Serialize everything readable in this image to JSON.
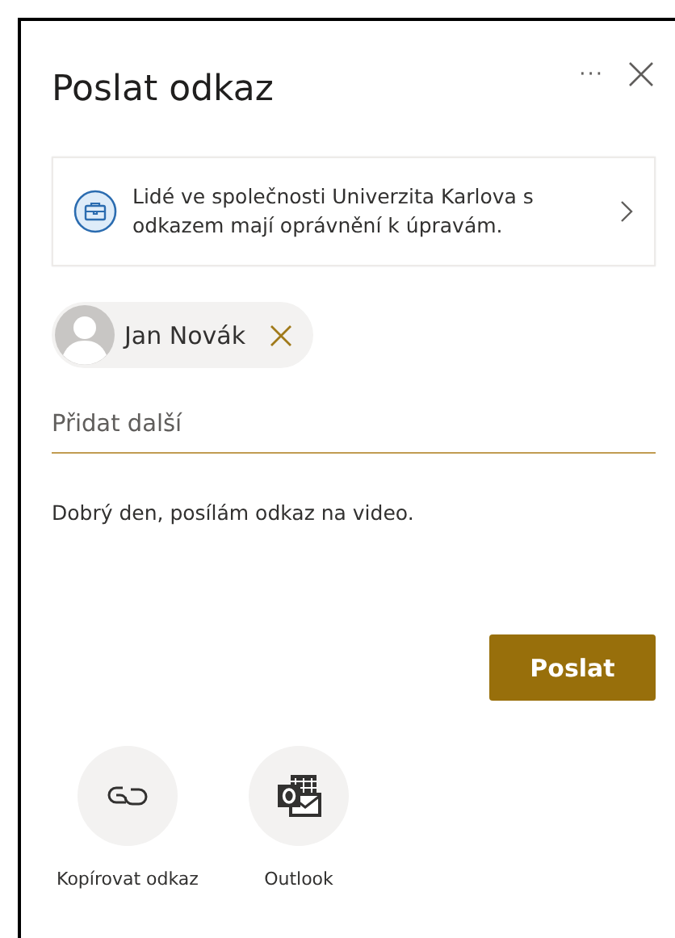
{
  "dialog": {
    "title": "Poslat odkaz",
    "more_menu": "···"
  },
  "permission": {
    "text": "Lidé ve společnosti Univerzita Karlova s odkazem mají oprávnění k úpravám."
  },
  "recipients": [
    {
      "name": "Jan Novák"
    }
  ],
  "add_field": {
    "placeholder": "Přidat další"
  },
  "message": {
    "value": "Dobrý den, posílám odkaz na video."
  },
  "send_button": "Poslat",
  "share_options": [
    {
      "kind": "link",
      "label": "Kopírovat odkaz"
    },
    {
      "kind": "outlook",
      "label": "Outlook"
    }
  ]
}
